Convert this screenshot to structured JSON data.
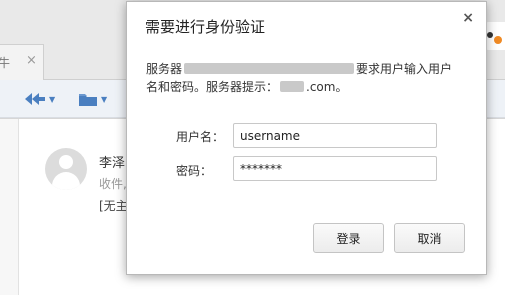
{
  "background": {
    "tab": {
      "label": "牛",
      "close": "×"
    },
    "sender_name": "李泽",
    "recipients_label": "收件,",
    "subject": "[无主",
    "toolbar_icons": [
      "reply-all-icon",
      "folder-icon"
    ]
  },
  "dialog": {
    "title": "需要进行身份验证",
    "close": "×",
    "message": {
      "server_prefix": "服务器",
      "server_suffix": "要求用户输入用户",
      "line2_prefix": "名和密码。服务器提示：",
      "line2_suffix": ".com。"
    },
    "username": {
      "label": "用户名：",
      "value": "username"
    },
    "password": {
      "label": "密码：",
      "value": "*******"
    },
    "login_button": "登录",
    "cancel_button": "取消"
  },
  "colors": {
    "accent_blue": "#4a7fc0",
    "dialog_bg": "#ffffff"
  }
}
